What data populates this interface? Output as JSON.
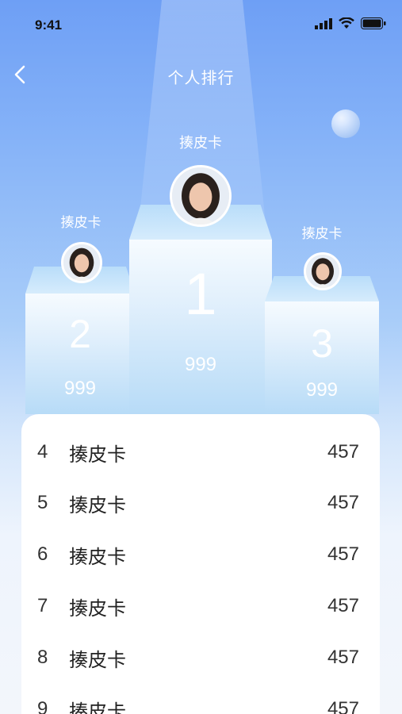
{
  "status": {
    "time": "9:41"
  },
  "header": {
    "title": "个人排行"
  },
  "podium": [
    {
      "rank": "1",
      "name": "揍皮卡",
      "score": "999"
    },
    {
      "rank": "2",
      "name": "揍皮卡",
      "score": "999"
    },
    {
      "rank": "3",
      "name": "揍皮卡",
      "score": "999"
    }
  ],
  "list": [
    {
      "rank": "4",
      "name": "揍皮卡",
      "score": "457"
    },
    {
      "rank": "5",
      "name": "揍皮卡",
      "score": "457"
    },
    {
      "rank": "6",
      "name": "揍皮卡",
      "score": "457"
    },
    {
      "rank": "7",
      "name": "揍皮卡",
      "score": "457"
    },
    {
      "rank": "8",
      "name": "揍皮卡",
      "score": "457"
    },
    {
      "rank": "9",
      "name": "揍皮卡",
      "score": "457"
    }
  ],
  "colors": {
    "accent": "#6e9ff5",
    "podium": "#b7dbf7"
  }
}
